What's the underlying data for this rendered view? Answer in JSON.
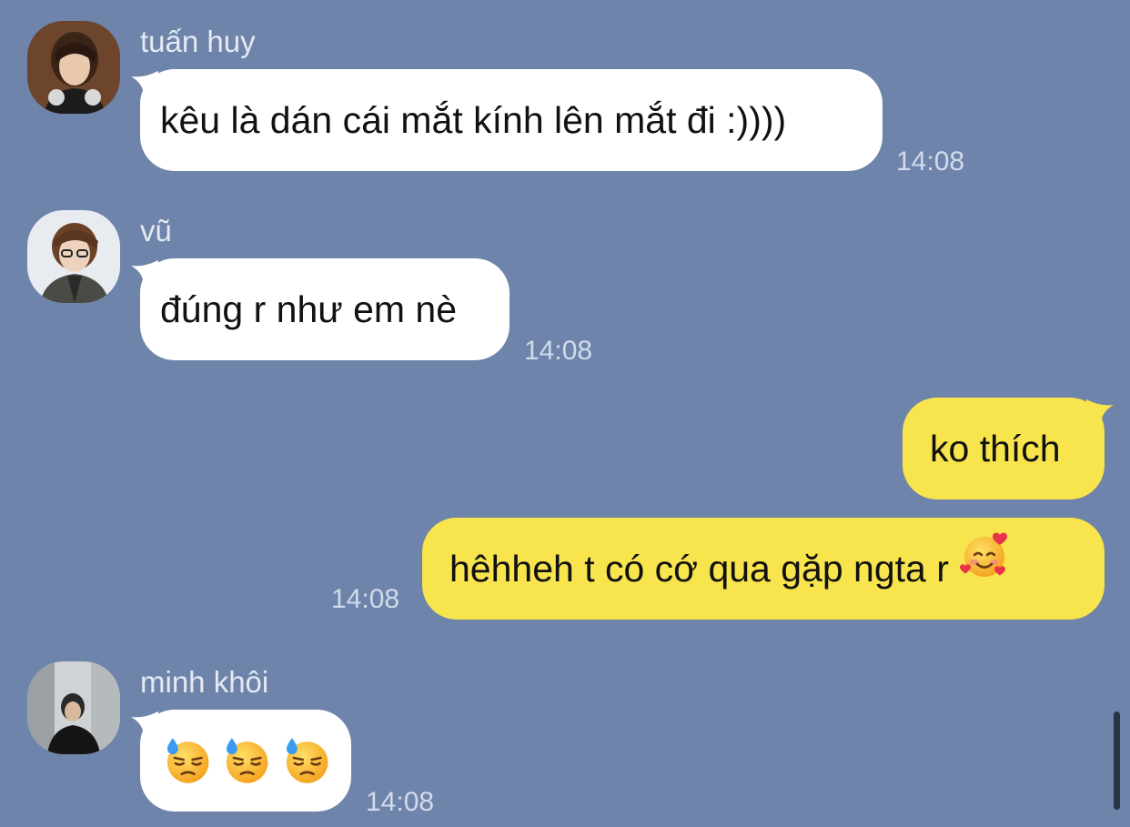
{
  "messages": [
    {
      "sender": "tuấn huy",
      "avatar_icon": "avatar-tuan-huy",
      "text": "kêu là dán cái mắt kính lên mắt đi :))))",
      "time": "14:08",
      "direction": "incoming"
    },
    {
      "sender": "vũ",
      "avatar_icon": "avatar-vu",
      "text": "đúng r như em nè",
      "time": "14:08",
      "direction": "incoming"
    },
    {
      "text": "ko thích",
      "direction": "outgoing"
    },
    {
      "text": "hêhheh t có cớ qua gặp ngta r",
      "emoji": "smiling-face-with-hearts",
      "time": "14:08",
      "direction": "outgoing"
    },
    {
      "sender": "minh khôi",
      "avatar_icon": "avatar-minh-khoi",
      "emojis": [
        "downcast-face-with-sweat",
        "downcast-face-with-sweat",
        "downcast-face-with-sweat"
      ],
      "time": "14:08",
      "direction": "incoming"
    }
  ],
  "colors": {
    "background": "#6e84aa",
    "incoming_bubble": "#ffffff",
    "outgoing_bubble": "#f8e44c",
    "sender_name": "#e4e9f2",
    "timestamp": "#d3dbea"
  }
}
